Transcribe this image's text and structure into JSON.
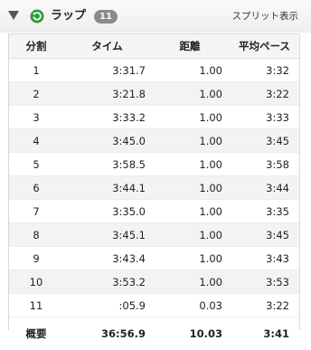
{
  "header": {
    "title": "ラップ",
    "badge_count": "11",
    "split_link": "スプリット表示"
  },
  "table": {
    "columns": [
      "分割",
      "タイム",
      "距離",
      "平均ペース"
    ],
    "rows": [
      [
        "1",
        "3:31.7",
        "1.00",
        "3:32"
      ],
      [
        "2",
        "3:21.8",
        "1.00",
        "3:22"
      ],
      [
        "3",
        "3:33.2",
        "1.00",
        "3:33"
      ],
      [
        "4",
        "3:45.0",
        "1.00",
        "3:45"
      ],
      [
        "5",
        "3:58.5",
        "1.00",
        "3:58"
      ],
      [
        "6",
        "3:44.1",
        "1.00",
        "3:44"
      ],
      [
        "7",
        "3:35.0",
        "1.00",
        "3:35"
      ],
      [
        "8",
        "3:45.1",
        "1.00",
        "3:45"
      ],
      [
        "9",
        "3:43.4",
        "1.00",
        "3:43"
      ],
      [
        "10",
        "3:53.2",
        "1.00",
        "3:53"
      ],
      [
        "11",
        ":05.9",
        "0.03",
        "3:22"
      ]
    ],
    "summary": [
      "概要",
      "36:56.9",
      "10.03",
      "3:41"
    ]
  },
  "colors": {
    "icon_green": "#2e9e3a",
    "badge_gray": "#8a8a8a"
  },
  "icons": {
    "collapse": "triangle-down-icon",
    "laps": "laps-refresh-icon"
  }
}
